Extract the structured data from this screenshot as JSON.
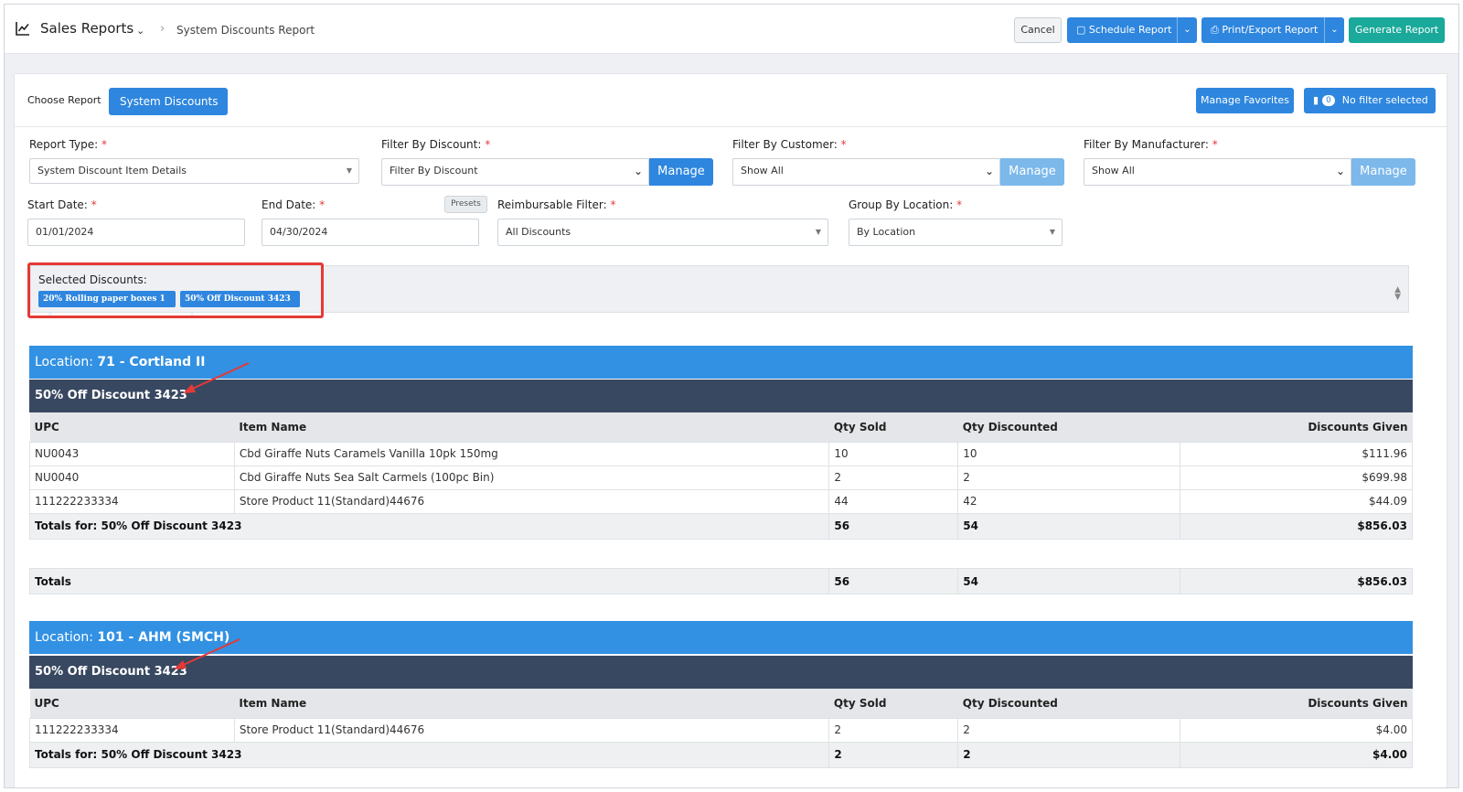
{
  "header": {
    "title": "Sales Reports",
    "breadcrumb": "System Discounts Report",
    "cancel_label": "Cancel",
    "schedule_label": "Schedule Report",
    "print_label": "Print/Export Report",
    "generate_label": "Generate Report"
  },
  "toolbar": {
    "choose_label": "Choose Report",
    "choose_value": "System Discounts",
    "manage_favorites_label": "Manage Favorites",
    "filter_count": "0",
    "no_filter_label": "No filter selected"
  },
  "filters": {
    "report_type": {
      "label": "Report Type:",
      "value": "System Discount Item Details"
    },
    "discount": {
      "label": "Filter By Discount:",
      "value": "Filter By Discount",
      "manage": "Manage"
    },
    "customer": {
      "label": "Filter By Customer:",
      "value": "Show All",
      "manage": "Manage"
    },
    "manufacturer": {
      "label": "Filter By Manufacturer:",
      "value": "Show All",
      "manage": "Manage"
    },
    "start_date": {
      "label": "Start Date:",
      "value": "01/01/2024"
    },
    "end_date": {
      "label": "End Date:",
      "value": "04/30/2024",
      "presets": "Presets"
    },
    "reimbursable": {
      "label": "Reimbursable Filter:",
      "value": "All Discounts"
    },
    "group_by": {
      "label": "Group By Location:",
      "value": "By Location"
    },
    "required_mark": "*"
  },
  "selected_discounts": {
    "label": "Selected Discounts:",
    "tags": [
      "20% Rolling paper boxes 1",
      "50% Off Discount 3423"
    ]
  },
  "columns": [
    "UPC",
    "Item Name",
    "Qty Sold",
    "Qty Discounted",
    "Discounts Given"
  ],
  "location_prefix": "Location:",
  "sections": [
    {
      "location": "71 - Cortland II",
      "discount": "50% Off Discount 3423",
      "rows": [
        {
          "upc": "NU0043",
          "item": "Cbd Giraffe Nuts Caramels Vanilla 10pk 150mg",
          "qty_sold": "10",
          "qty_disc": "10",
          "given": "$111.96"
        },
        {
          "upc": "NU0040",
          "item": "Cbd Giraffe Nuts Sea Salt Carmels (100pc Bin)",
          "qty_sold": "2",
          "qty_disc": "2",
          "given": "$699.98"
        },
        {
          "upc": "111222233334",
          "item": "Store Product 11(Standard)44676",
          "qty_sold": "44",
          "qty_disc": "42",
          "given": "$44.09"
        }
      ],
      "totals": {
        "label": "Totals for: 50% Off Discount 3423",
        "qty_sold": "56",
        "qty_disc": "54",
        "given": "$856.03"
      },
      "grand": {
        "label": "Totals",
        "qty_sold": "56",
        "qty_disc": "54",
        "given": "$856.03"
      }
    },
    {
      "location": "101 - AHM (SMCH)",
      "discount": "50% Off Discount 3423",
      "rows": [
        {
          "upc": "111222233334",
          "item": "Store Product 11(Standard)44676",
          "qty_sold": "2",
          "qty_disc": "2",
          "given": "$4.00"
        }
      ],
      "totals": {
        "label": "Totals for: 50% Off Discount 3423",
        "qty_sold": "2",
        "qty_disc": "2",
        "given": "$4.00"
      }
    }
  ],
  "colors": {
    "primary": "#2e86de",
    "success": "#1aa99a",
    "location_bar": "#3291e3",
    "discount_bar": "#394861",
    "highlight": "#e53935"
  }
}
